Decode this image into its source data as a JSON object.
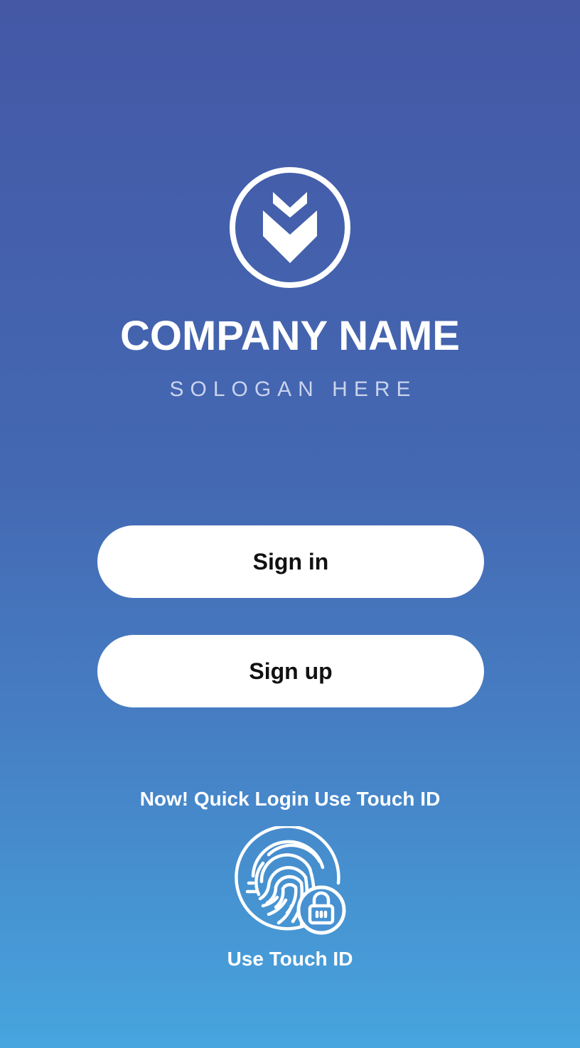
{
  "brand": {
    "company_name": "COMPANY NAME",
    "slogan": "SOLOGAN HERE",
    "logo_icon": "chevron-down-shield-icon"
  },
  "auth": {
    "sign_in_label": "Sign in",
    "sign_up_label": "Sign up"
  },
  "touch_id": {
    "promo_text": "Now! Quick Login Use Touch ID",
    "icon": "fingerprint-lock-icon",
    "label": "Use Touch ID"
  },
  "colors": {
    "gradient_top": "#4458a6",
    "gradient_bottom": "#47a5de",
    "button_bg": "#ffffff",
    "button_text": "#111111",
    "text": "#ffffff"
  }
}
